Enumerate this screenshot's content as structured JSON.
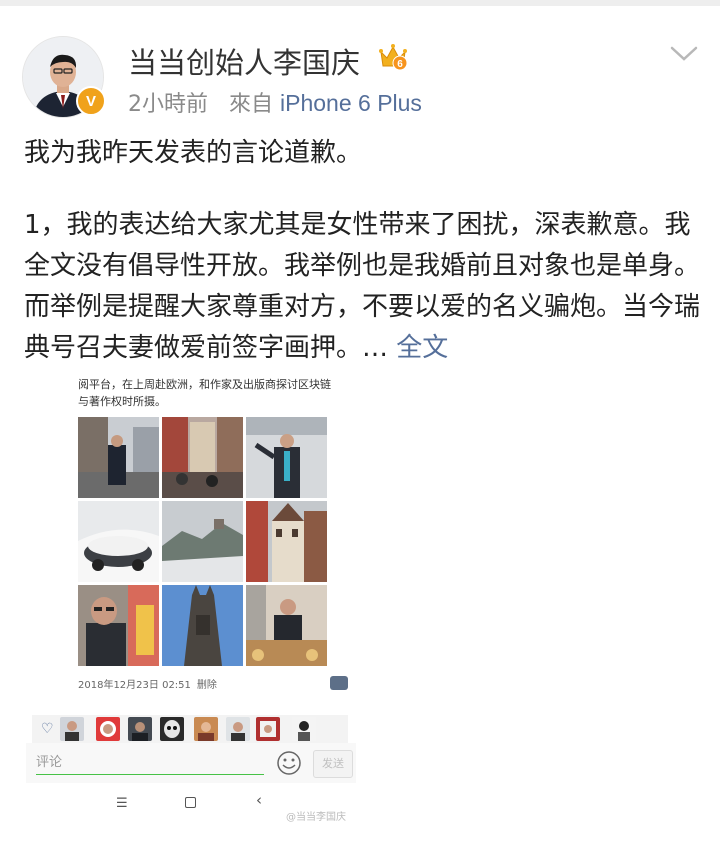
{
  "post": {
    "author": "当当创始人李国庆",
    "time": "2小時前",
    "source_prefix": "來自",
    "source_device": "iPhone 6 Plus",
    "paragraph1": "我为我昨天发表的言论道歉。",
    "paragraph2": "1，我的表达给大家尤其是女性带来了困扰，深表歉意。我全文没有倡导性开放。我举例也是我婚前且对象也是单身。而举例是提醒大家尊重对方，不要以爱的名义骗炮。当今瑞典号召夫妻做爱前签字画押。",
    "more_ellipsis": "…",
    "more_link": "全文",
    "badge_letter": "V",
    "crown_level": "6"
  },
  "embedded": {
    "caption": "阅平台，在上周赴欧洲，和作家及出版商探讨区块链与著作权时所摄。",
    "timestamp": "2018年12月23日 02:51",
    "delete_label": "删除",
    "comment_placeholder": "评论",
    "send_label": "发送",
    "watermark": "@当当李国庆"
  },
  "nav": {
    "menu_glyph": "☰",
    "back_glyph": "‹"
  },
  "colors": {
    "link": "#556f9a",
    "meta_gray": "#8a8a8a",
    "vip_orange": "#f0a21b",
    "input_underline": "#47c247"
  },
  "icons": {
    "chevron": "chevron-down-icon",
    "crown": "crown-icon",
    "verified": "verified-badge-icon",
    "heart": "heart-icon",
    "emoji": "smiley-icon"
  }
}
